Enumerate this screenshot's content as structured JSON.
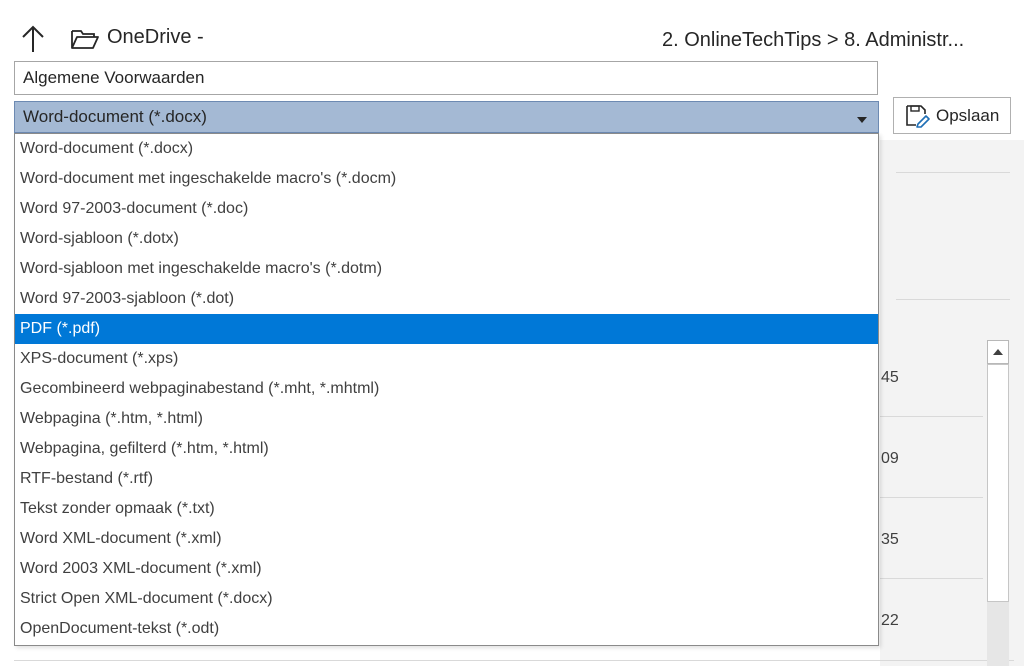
{
  "header": {
    "location": "OneDrive -",
    "breadcrumb": "2. OnlineTechTips > 8. Administr..."
  },
  "filename": {
    "value": "Algemene Voorwaarden"
  },
  "filetype": {
    "selected": "Word-document (*.docx)",
    "options": [
      "Word-document (*.docx)",
      "Word-document met ingeschakelde macro's (*.docm)",
      "Word 97-2003-document (*.doc)",
      "Word-sjabloon (*.dotx)",
      "Word-sjabloon met ingeschakelde macro's (*.dotm)",
      "Word 97-2003-sjabloon (*.dot)",
      "PDF (*.pdf)",
      "XPS-document (*.xps)",
      "Gecombineerd webpaginabestand (*.mht, *.mhtml)",
      "Webpagina (*.htm, *.html)",
      "Webpagina, gefilterd (*.htm, *.html)",
      "RTF-bestand (*.rtf)",
      "Tekst zonder opmaak (*.txt)",
      "Word XML-document (*.xml)",
      "Word 2003 XML-document (*.xml)",
      "Strict Open XML-document (*.docx)",
      "OpenDocument-tekst (*.odt)"
    ],
    "highlighted": "PDF (*.pdf)"
  },
  "save_button": {
    "label": "Opslaan"
  },
  "side_numbers": [
    "45",
    "09",
    "35",
    "22"
  ],
  "icons": {
    "nav_up": "arrow-up-icon",
    "folder": "folder-open-icon",
    "dropdown": "chevron-down-icon",
    "save": "save-icon",
    "scroll_up": "scroll-up-arrow-icon"
  },
  "colors": {
    "selected_option_bg": "#0078d7",
    "filetype_bg": "#a4b9d4"
  }
}
